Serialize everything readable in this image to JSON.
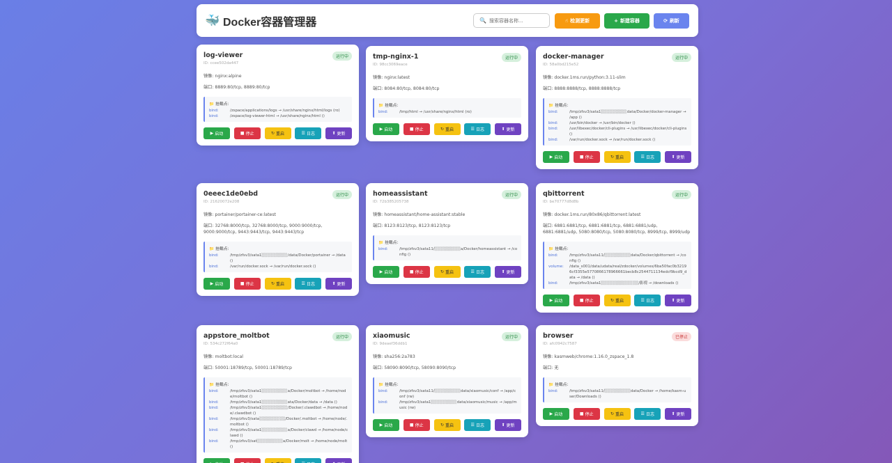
{
  "header": {
    "logo_icon": "🐳",
    "title": "Docker容器管理器",
    "search_placeholder": "搜索容器名称...",
    "check_update": "检测更新",
    "new_container": "新建容器",
    "refresh": "刷新"
  },
  "labels": {
    "image_prefix": "镜像:",
    "port_prefix": "端口:",
    "mounts_title": "挂载点:",
    "start": "启动",
    "stop": "停止",
    "restart": "重启",
    "logs": "日志",
    "update": "更新"
  },
  "containers": [
    {
      "name": "log-viewer",
      "status": "运行中",
      "status_type": "run",
      "id": "ID: ccee502da447",
      "image": "镜像: nginx:alpine",
      "ports": "端口: 8889:80/tcp, 8889:80/tcp",
      "mounts": [
        {
          "type": "bind:",
          "value": "/zspace/applications/logs → /usr/share/nginx/html/logs (ro)"
        },
        {
          "type": "bind:",
          "value": "/zspace/log-viewer-html → /usr/share/nginx/html ()"
        }
      ]
    },
    {
      "name": "tmp-nginx-1",
      "status": "运行中",
      "status_type": "run",
      "id": "ID: 98cc3069eace",
      "image": "镜像: nginx:latest",
      "ports": "端口: 8084:80/tcp, 8084:80/tcp",
      "mounts": [
        {
          "type": "bind:",
          "value": "/tmp/html → /usr/share/nginx/html (ro)"
        }
      ]
    },
    {
      "name": "docker-manager",
      "status": "运行中",
      "status_type": "run",
      "id": "ID: 58a0bd215e52",
      "image": "镜像: docker.1ms.run/python:3.11-slim",
      "ports": "端口: 8888:8888/tcp, 8888:8888/tcp",
      "mounts": [
        {
          "type": "bind:",
          "value": "/tmp/zfsv3/sata1░░░░░░░░░data/Docker/docker-manager → /app ()"
        },
        {
          "type": "bind:",
          "value": "/usr/bin/docker → /usr/bin/docker ()"
        },
        {
          "type": "bind:",
          "value": "/usr/libexec/docker/cli-plugins → /usr/libexec/docker/cli-plugins ()"
        },
        {
          "type": "bind:",
          "value": "/var/run/docker.sock → /var/run/docker.sock ()"
        }
      ]
    },
    {
      "name": "0eeec1de0ebd",
      "status": "运行中",
      "status_type": "run",
      "id": "ID: 21620072e208",
      "image": "镜像: portainer/portainer-ce:latest",
      "ports": "端口: 32768:8000/tcp, 32768:8000/tcp, 9000:9000/tcp, 9000:9000/tcp, 9443:9443/tcp, 9443:9443/tcp",
      "mounts": [
        {
          "type": "bind:",
          "value": "/tmp/zfsv3/sata1░░░░░░░░░/data/Docker/portainer → /data ()"
        },
        {
          "type": "bind:",
          "value": "/var/run/docker.sock → /var/run/docker.sock ()"
        }
      ]
    },
    {
      "name": "homeassistant",
      "status": "运行中",
      "status_type": "run",
      "id": "ID: 72b385205738",
      "image": "镜像: homeassistant/home-assistant:stable",
      "ports": "端口: 8123:8123/tcp, 8123:8123/tcp",
      "mounts": [
        {
          "type": "bind:",
          "value": "/tmp/zfsv3/sata11/░░░░░░░░░a/Docker/homeassistant → /config ()"
        }
      ]
    },
    {
      "name": "qbittorrent",
      "status": "运行中",
      "status_type": "run",
      "id": "ID: be70777d8d8b",
      "image": "镜像: docker.1ms.run/80x86/qbittorrent:latest",
      "ports": "端口: 6881:6881/tcp, 6881:6881/tcp, 6881:6881/udp, 6881:6881/udp, 5080:8080/tcp, 5080:8080/tcp, 8999/tcp, 8999/udp",
      "mounts": [
        {
          "type": "bind:",
          "value": "/tmp/zfsv3/sata11/░░░░░░░░░data/Docker/qbittorrent → /config ()"
        },
        {
          "type": "volume:",
          "value": "/data_s001/data/udata/real/zdocker/volumes/6ba50fac0b32196cf3355e5770866178966661becb8c2544711134edcf9bcd9_data → /data ()"
        },
        {
          "type": "bind:",
          "value": "/tmp/zfsv3/sata1░░░░░░░░░░░░░/影视 → /downloads ()"
        }
      ]
    },
    {
      "name": "appstore_moltbot",
      "status": "运行中",
      "status_type": "run",
      "id": "ID: 534c272f64a0",
      "image": "镜像: moltbot:local",
      "ports": "端口: 50001:18789/tcp, 50001:18789/tcp",
      "mounts": [
        {
          "type": "bind:",
          "value": "/tmp/zfsv3/sata1░░░░░░░░░a/Docker/moltbot → /home/node/moltbot ()"
        },
        {
          "type": "bind:",
          "value": "/tmp/zfsv3/sata1░░░░░░░░░ata/Docker/data → /data ()"
        },
        {
          "type": "bind:",
          "value": "/tmp/zfsv3/sata1░░░░░░░░░/Docker/.clawdbot → /home/node/.clawdbot ()"
        },
        {
          "type": "bind:",
          "value": "/tmp/zfsv3/sata░░░░░░░░░/Docker/.moltbot → /home/node/.moltbot ()"
        },
        {
          "type": "bind:",
          "value": "/tmp/zfsv3/sata1░░░░░░░░░a/Docker/clawd → /home/node/clawd ()"
        },
        {
          "type": "bind:",
          "value": "/tmp/zfsv3/sat░░░░░░░░░a/Docker/molt → /home/node/molt ()"
        }
      ]
    },
    {
      "name": "xiaomusic",
      "status": "运行中",
      "status_type": "run",
      "id": "ID: 9deaef36ddb1",
      "image": "镜像: sha256:2a783",
      "ports": "端口: 58090:8090/tcp, 58090:8090/tcp",
      "mounts": [
        {
          "type": "bind:",
          "value": "/tmp/zfsv3/sata11/░░░░░░░░░data/xiaomusic/conf → /app/conf (rw)"
        },
        {
          "type": "bind:",
          "value": "/tmp/zfsv3/sata1░░░░░░░░░data/xiaomusic/music → /app/music (rw)"
        }
      ]
    },
    {
      "name": "browser",
      "status": "已停止",
      "status_type": "stop",
      "id": "ID: afc0942c7587",
      "image": "镜像: kasmweb/chrome:1.16.0_zspace_1.8",
      "ports": "端口: 无",
      "mounts": [
        {
          "type": "bind:",
          "value": "/tmp/zfsv3/sata11/░░░░░░░░░data/Docker → /home/kasm-user/Downloads ()"
        }
      ]
    }
  ]
}
